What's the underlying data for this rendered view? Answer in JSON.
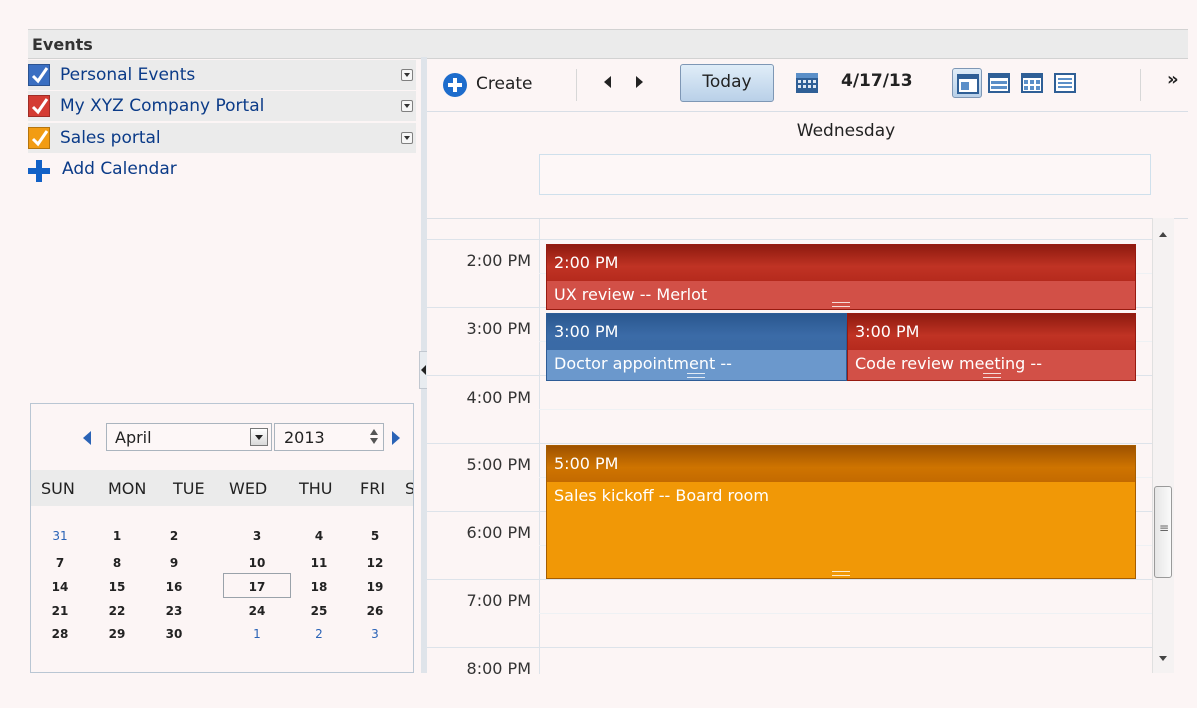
{
  "header": {
    "title": "Events"
  },
  "calendars": [
    {
      "label": "Personal Events",
      "color": "#3a6fc2"
    },
    {
      "label": "My XYZ Company Portal",
      "color": "#d43c33"
    },
    {
      "label": "Sales portal",
      "color": "#f29c13"
    }
  ],
  "add_calendar": {
    "label": "Add Calendar"
  },
  "mini_calendar": {
    "month": "April",
    "year": "2013",
    "weekday_headers": [
      "SUN",
      "MON",
      "TUE",
      "WED",
      "THU",
      "FRI",
      "S"
    ],
    "weeks": [
      [
        "31",
        "1",
        "2",
        "3",
        "4",
        "5"
      ],
      [
        "7",
        "8",
        "9",
        "10",
        "11",
        "12"
      ],
      [
        "14",
        "15",
        "16",
        "17",
        "18",
        "19"
      ],
      [
        "21",
        "22",
        "23",
        "24",
        "25",
        "26"
      ],
      [
        "28",
        "29",
        "30",
        "1",
        "2",
        "3"
      ]
    ],
    "selected_day": "17"
  },
  "toolbar": {
    "create_label": "Create",
    "today_label": "Today",
    "current_date": "4/17/13",
    "overflow": "»"
  },
  "day_view": {
    "day_name": "Wednesday",
    "time_labels": [
      "2:00 PM",
      "3:00 PM",
      "4:00 PM",
      "5:00 PM",
      "6:00 PM",
      "7:00 PM",
      "8:00 PM"
    ],
    "events": [
      {
        "time": "2:00 PM",
        "title": "UX review -- Merlot"
      },
      {
        "time": "3:00 PM",
        "title": "Doctor appointment --"
      },
      {
        "time": "3:00 PM",
        "title": "Code review meeting --"
      },
      {
        "time": "5:00 PM",
        "title": "Sales kickoff -- Board room"
      }
    ]
  }
}
